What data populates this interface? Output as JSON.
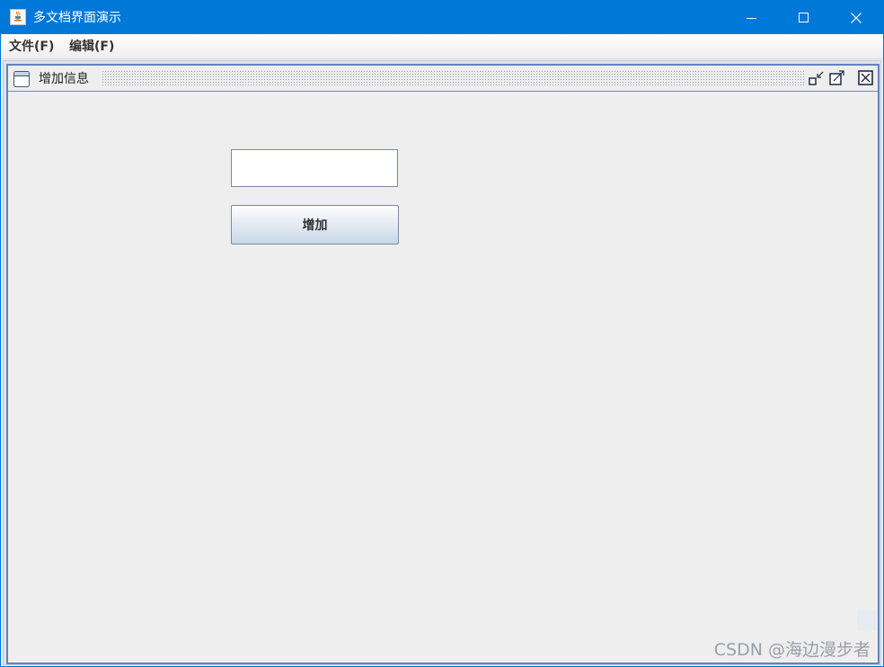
{
  "window": {
    "title": "多文档界面演示"
  },
  "menubar": {
    "items": [
      {
        "label": "文件(F)"
      },
      {
        "label": "编辑(F)"
      }
    ]
  },
  "internal_frame": {
    "title": "增加信息",
    "icon": "window-icon",
    "buttons": [
      "iconify-icon",
      "maximize-icon",
      "close-icon"
    ]
  },
  "form": {
    "text_field_value": "",
    "add_button_label": "增加"
  },
  "watermark": {
    "text": "CSDN @海边漫步者"
  },
  "colors": {
    "titlebar": "#0078d7",
    "frame_border": "#6382bf",
    "background": "#eeeeee"
  }
}
